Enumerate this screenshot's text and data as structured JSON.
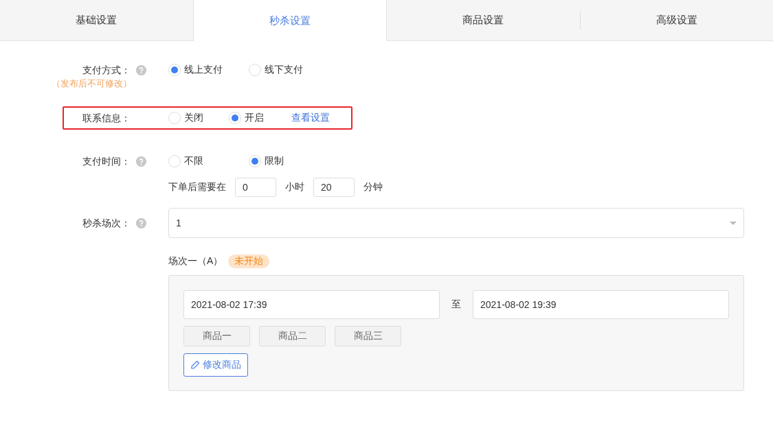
{
  "tabs": [
    {
      "label": "基础设置",
      "selected": false
    },
    {
      "label": "秒杀设置",
      "selected": true
    },
    {
      "label": "商品设置",
      "selected": false
    },
    {
      "label": "高级设置",
      "selected": false
    }
  ],
  "form": [
    {
      "label": "支付方式：",
      "note": "（发布后不可修改）",
      "help": true,
      "highlighted": false,
      "options": [
        {
          "label": "线上支付",
          "selected": true
        },
        {
          "label": "线下支付",
          "selected": false
        }
      ]
    },
    {
      "label": "联系信息：",
      "help": false,
      "highlighted": true,
      "options": [
        {
          "label": "关闭",
          "selected": false
        },
        {
          "label": "开启",
          "selected": true
        }
      ],
      "link": "查看设置"
    },
    {
      "label": "支付时间：",
      "help": true,
      "highlighted": false,
      "options": [
        {
          "label": "不限",
          "selected": false
        },
        {
          "label": "限制",
          "selected": true
        }
      ]
    }
  ],
  "time_limit": {
    "prefix": "下单后需要在",
    "hours": "0",
    "hours_unit": "小时",
    "minutes": "20",
    "minutes_unit": "分钟"
  },
  "session_count": {
    "label": "秒杀场次：",
    "help": true,
    "value": "1"
  },
  "session": {
    "title": "场次一（A）",
    "status": "未开始",
    "start": "2021-08-02 17:39",
    "separator": "至",
    "end": "2021-08-02 19:39",
    "products": [
      "商品一",
      "商品二",
      "商品三"
    ],
    "edit_button": "修改商品"
  }
}
